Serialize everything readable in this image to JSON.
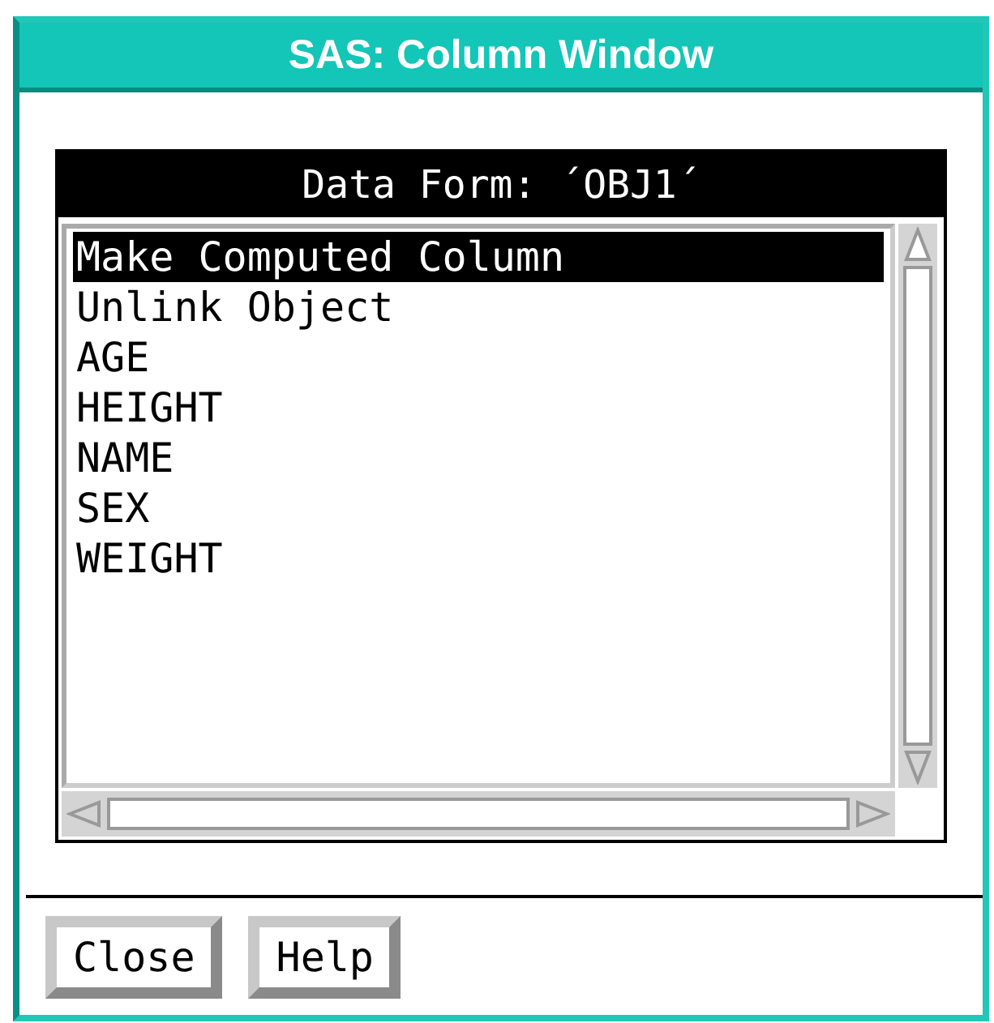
{
  "window": {
    "title": "SAS: Column Window"
  },
  "panel": {
    "title": "Data Form: ´OBJ1´"
  },
  "list": {
    "items": [
      {
        "label": "Make Computed Column",
        "selected": true
      },
      {
        "label": "Unlink Object",
        "selected": false
      },
      {
        "label": "AGE",
        "selected": false
      },
      {
        "label": "HEIGHT",
        "selected": false
      },
      {
        "label": "NAME",
        "selected": false
      },
      {
        "label": "SEX",
        "selected": false
      },
      {
        "label": "WEIGHT",
        "selected": false
      }
    ]
  },
  "buttons": [
    "Close",
    "Help"
  ]
}
